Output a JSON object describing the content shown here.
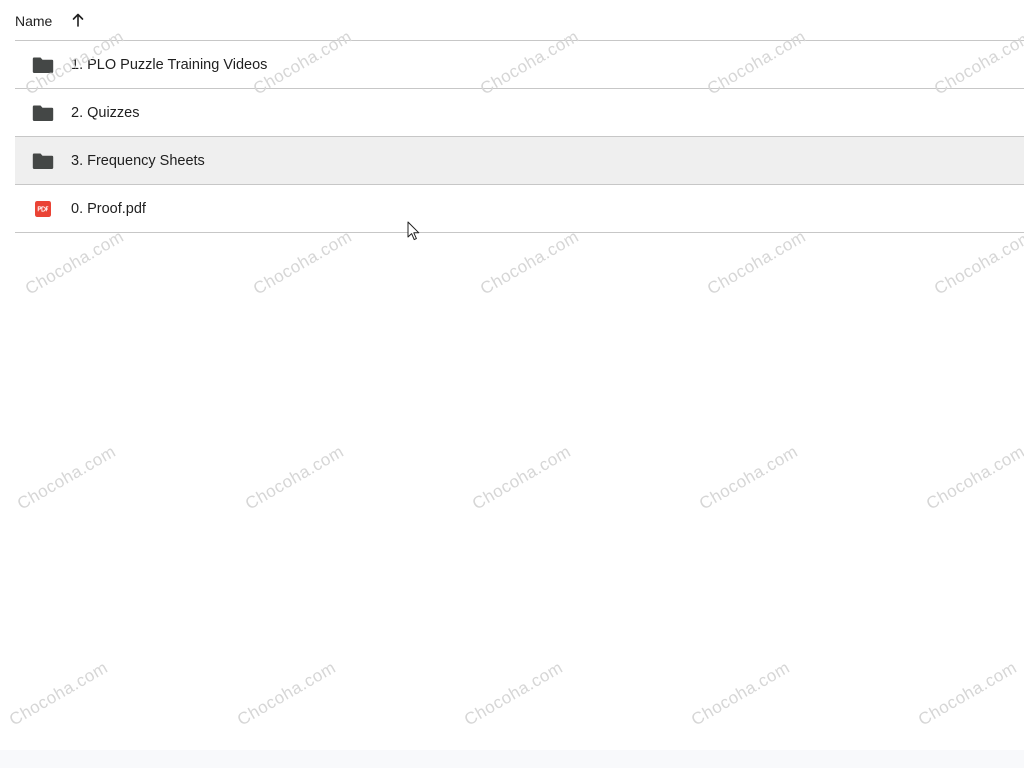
{
  "header": {
    "name_column": "Name",
    "sort_icon": "arrow-up-icon"
  },
  "files": [
    {
      "label": "1. PLO Puzzle Training Videos",
      "type": "folder",
      "icon": "folder-icon",
      "selected": false
    },
    {
      "label": "2. Quizzes",
      "type": "folder",
      "icon": "folder-icon",
      "selected": false
    },
    {
      "label": "3. Frequency Sheets",
      "type": "folder",
      "icon": "folder-icon",
      "selected": true
    },
    {
      "label": "0. Proof.pdf",
      "type": "pdf",
      "icon": "pdf-icon",
      "selected": false
    }
  ],
  "watermark": "Chocoha.com",
  "colors": {
    "folder": "#444746",
    "pdf": "#ea4335",
    "selected_row": "#efefef",
    "divider": "#c7c7c7"
  }
}
